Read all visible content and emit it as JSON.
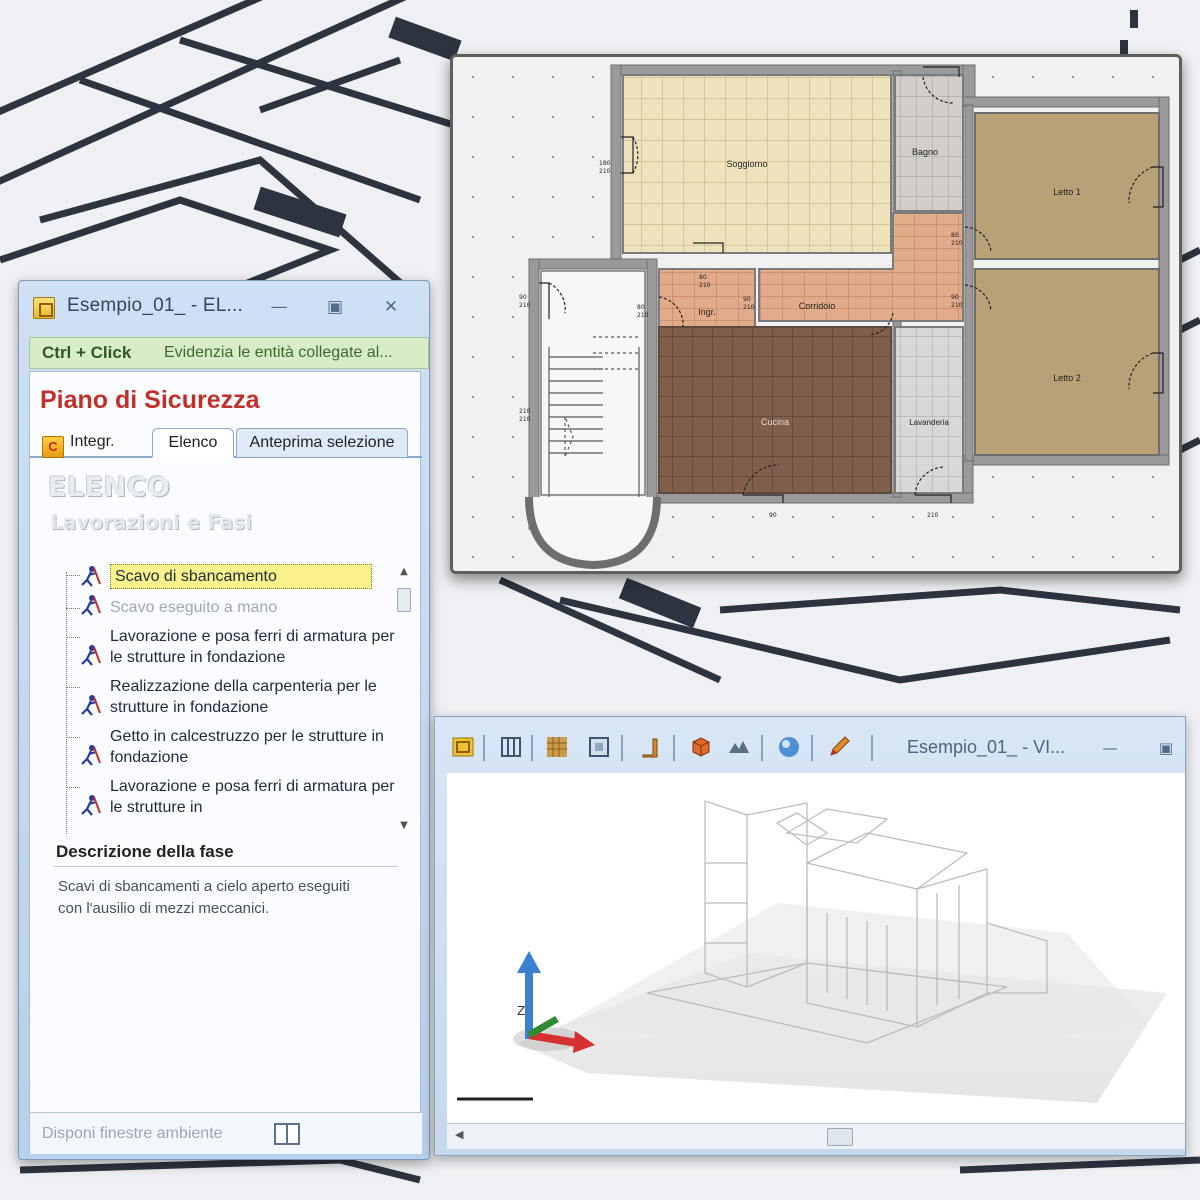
{
  "list_window": {
    "title": "Esempio_01_ - EL...",
    "hint": {
      "key": "Ctrl + Click",
      "text": "Evidenzia le entità collegate al..."
    },
    "panel_title": "Piano di Sicurezza",
    "tabs": [
      {
        "label": "Integr.",
        "icon": "c-app-icon"
      },
      {
        "label": "Elenco",
        "active": true
      },
      {
        "label": "Anteprima selezione"
      }
    ],
    "section_heading": "ELENCO",
    "section_sub": "Lavorazioni e Fasi",
    "phases": [
      {
        "label": "Scavo di sbancamento",
        "selected": true
      },
      {
        "label": "Scavo eseguito a mano",
        "dim": true
      },
      {
        "label": "Lavorazione e posa ferri di armatura per le strutture in fondazione"
      },
      {
        "label": "Realizzazione della carpenteria per le strutture in fondazione"
      },
      {
        "label": "Getto in calcestruzzo per le strutture in fondazione"
      },
      {
        "label": "Lavorazione e posa ferri di armatura per le strutture in"
      }
    ],
    "description_title": "Descrizione della fase",
    "description_text": "Scavi di sbancamenti a cielo aperto eseguiti con l'ausilio di mezzi meccanici.",
    "footer_label": "Disponi finestre ambiente"
  },
  "plan": {
    "rooms": {
      "soggiorno": "Soggiorno",
      "bagno": "Bagno",
      "letto1": "Letto 1",
      "letto2": "Letto 2",
      "ingr": "Ingr.",
      "corridoio": "Corridoio",
      "cucina": "Cucina",
      "lavanderia": "Lavanderia"
    },
    "dims": {
      "d1": "180",
      "d2": "210",
      "d3": "90",
      "d4": "210",
      "d5": "80",
      "d6": "210",
      "d7": "80",
      "d8": "210",
      "d9": "90",
      "d10": "210",
      "d11": "80",
      "d12": "210",
      "d13": "90",
      "d14": "210",
      "d15": "210",
      "d16": "210",
      "d17": "90",
      "d18": "210"
    },
    "colors": {
      "soggiorno": "#efe3bd",
      "bagno": "#d2cfcb",
      "letto": "#b9a177",
      "terracotta": "#e2ab8a",
      "cucina": "#80604c",
      "lavanderia": "#d8d8d8",
      "wall": "#8c8c8c"
    }
  },
  "view3d": {
    "title": "Esempio_01_ - VI...",
    "axis_z": "Z",
    "toolbar_icons": [
      "window-icon",
      "columns-icon",
      "texture-icon",
      "zoom-extents-icon",
      "wall-icon",
      "cube-icon",
      "landscape-icon",
      "sphere-icon",
      "pencil-icon"
    ]
  },
  "colors": {
    "accent_red": "#c0302a",
    "hint_green": "#d8ecc8",
    "selection_yellow": "#f9f28c"
  }
}
